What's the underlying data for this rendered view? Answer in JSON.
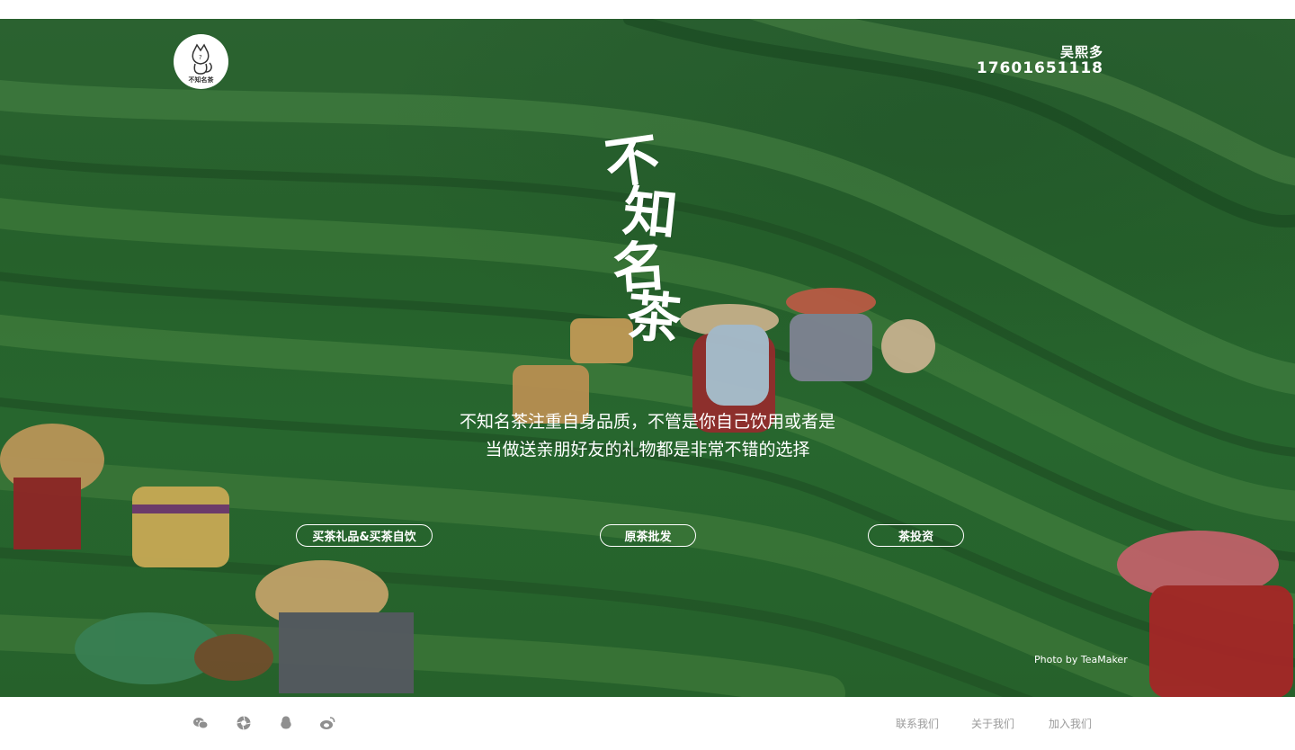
{
  "header": {
    "logo_text": "不知名茶",
    "contact_name": "吴熙多",
    "contact_phone": "17601651118"
  },
  "hero": {
    "brand_chars": [
      "不",
      "知",
      "名",
      "茶"
    ],
    "tagline_line1": "不知名茶注重自身品质，不管是你自己饮用或者是",
    "tagline_line2": "当做送亲朋好友的礼物都是非常不错的选择",
    "buttons": [
      {
        "label": "买茶礼品&买茶自饮"
      },
      {
        "label": "原茶批发"
      },
      {
        "label": "茶投资"
      }
    ],
    "photo_credit": "Photo by TeaMaker"
  },
  "footer": {
    "social_icons": [
      "wechat-icon",
      "camera-shutter-icon",
      "qq-icon",
      "weibo-icon"
    ],
    "links": [
      {
        "label": "联系我们"
      },
      {
        "label": "关于我们"
      },
      {
        "label": "加入我们"
      }
    ]
  },
  "colors": {
    "tea_green": "#2b6a30",
    "white": "#ffffff",
    "footer_link": "#9a9a9a",
    "icon_gray": "#8f8f8f"
  }
}
